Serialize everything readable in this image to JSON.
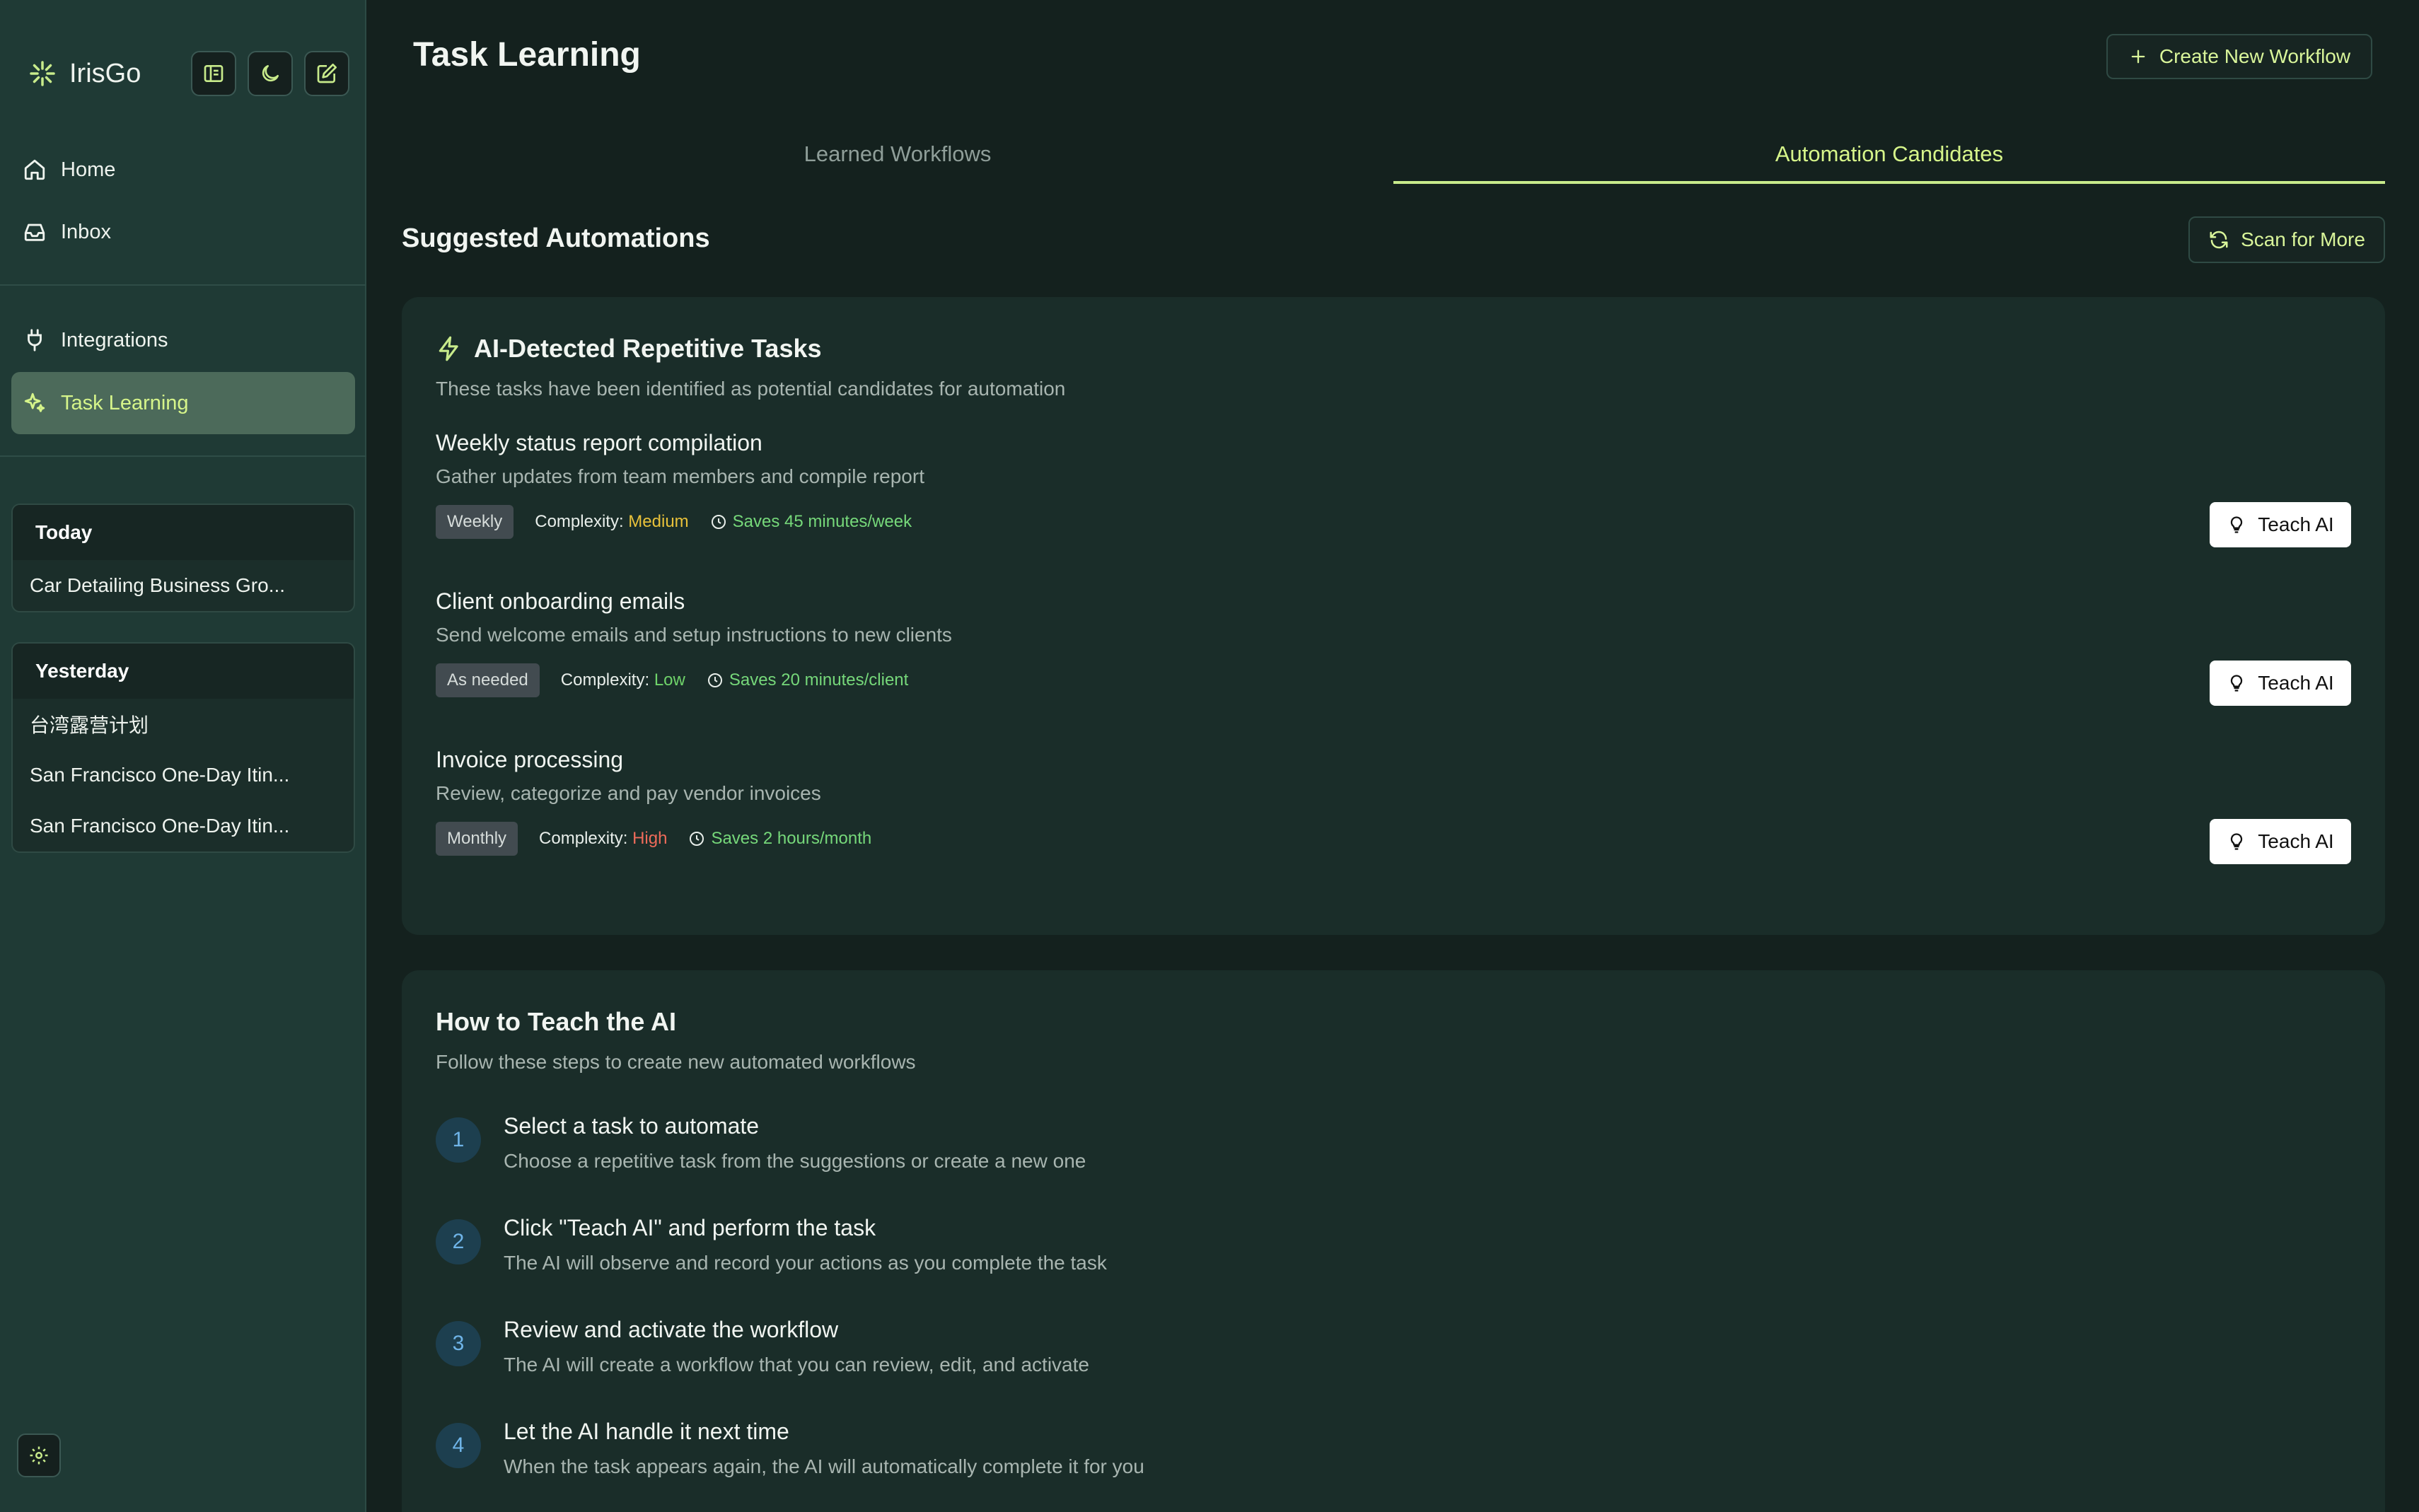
{
  "app": {
    "name": "IrisGo"
  },
  "sidebar": {
    "nav": [
      {
        "label": "Home",
        "icon": "home-icon"
      },
      {
        "label": "Inbox",
        "icon": "inbox-icon"
      },
      {
        "label": "Integrations",
        "icon": "plug-icon"
      },
      {
        "label": "Task Learning",
        "icon": "sparkles-icon",
        "active": true
      }
    ],
    "history": [
      {
        "heading": "Today",
        "items": [
          "Car Detailing Business Gro..."
        ]
      },
      {
        "heading": "Yesterday",
        "items": [
          "台湾露营计划",
          "San Francisco One-Day Itin...",
          "San Francisco One-Day Itin..."
        ]
      }
    ]
  },
  "header": {
    "title": "Task Learning",
    "create_label": "Create New Workflow"
  },
  "tabs": [
    {
      "label": "Learned Workflows",
      "active": false
    },
    {
      "label": "Automation Candidates",
      "active": true
    }
  ],
  "suggested": {
    "title": "Suggested Automations",
    "scan_label": "Scan for More"
  },
  "detected": {
    "title": "AI-Detected Repetitive Tasks",
    "subtitle": "These tasks have been identified as potential candidates for automation",
    "complexity_label": "Complexity:",
    "teach_label": "Teach AI",
    "tasks": [
      {
        "title": "Weekly status report compilation",
        "description": "Gather updates from team members and compile report",
        "frequency": "Weekly",
        "complexity": "Medium",
        "saves": "Saves 45 minutes/week"
      },
      {
        "title": "Client onboarding emails",
        "description": "Send welcome emails and setup instructions to new clients",
        "frequency": "As needed",
        "complexity": "Low",
        "saves": "Saves 20 minutes/client"
      },
      {
        "title": "Invoice processing",
        "description": "Review, categorize and pay vendor invoices",
        "frequency": "Monthly",
        "complexity": "High",
        "saves": "Saves 2 hours/month"
      }
    ]
  },
  "howto": {
    "title": "How to Teach the AI",
    "subtitle": "Follow these steps to create new automated workflows",
    "steps": [
      {
        "num": "1",
        "title": "Select a task to automate",
        "desc": "Choose a repetitive task from the suggestions or create a new one"
      },
      {
        "num": "2",
        "title": "Click \"Teach AI\" and perform the task",
        "desc": "The AI will observe and record your actions as you complete the task"
      },
      {
        "num": "3",
        "title": "Review and activate the workflow",
        "desc": "The AI will create a workflow that you can review, edit, and activate"
      },
      {
        "num": "4",
        "title": "Let the AI handle it next time",
        "desc": "When the task appears again, the AI will automatically complete it for you"
      }
    ]
  },
  "colors": {
    "accent": "#d6f58a",
    "sidebar_bg": "#1f3a35",
    "main_bg": "#14211e",
    "complexity_medium": "#e8c13a",
    "complexity_low": "#6fd36a",
    "complexity_high": "#ee6b5a"
  }
}
